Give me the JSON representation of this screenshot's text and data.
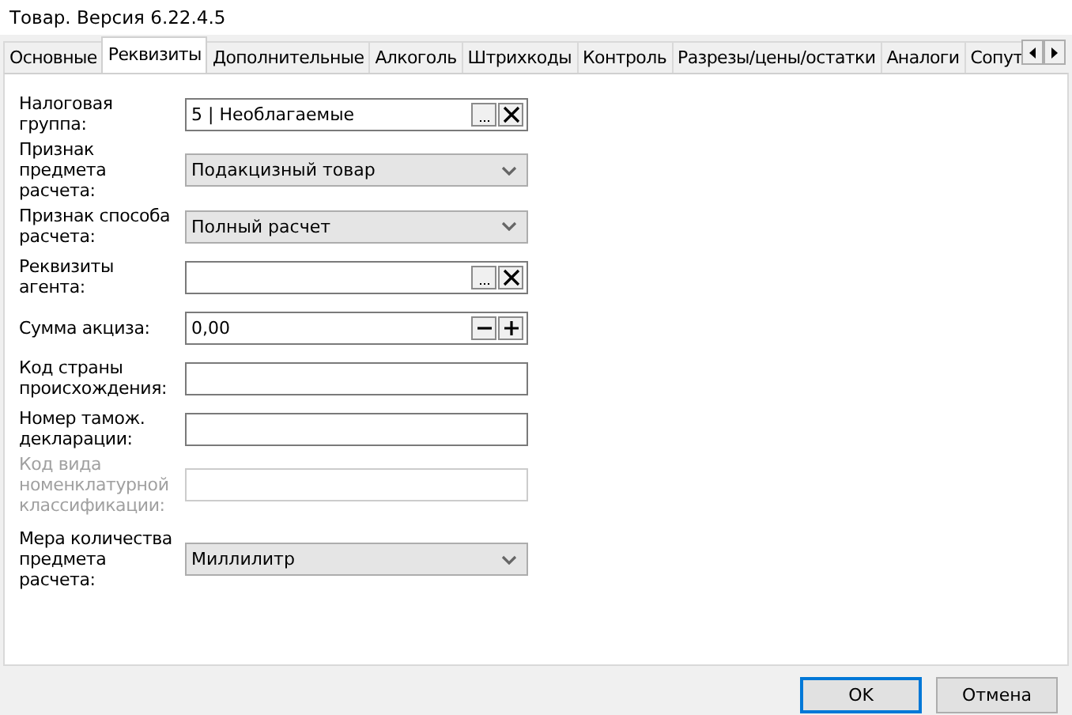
{
  "window": {
    "title": "Товар. Версия 6.22.4.5"
  },
  "tabs": [
    {
      "label": "Основные",
      "selected": false
    },
    {
      "label": "Реквизиты",
      "selected": true
    },
    {
      "label": "Дополнительные",
      "selected": false
    },
    {
      "label": "Алкоголь",
      "selected": false
    },
    {
      "label": "Штрихкоды",
      "selected": false
    },
    {
      "label": "Контроль",
      "selected": false
    },
    {
      "label": "Разрезы/цены/остатки",
      "selected": false
    },
    {
      "label": "Аналоги",
      "selected": false
    },
    {
      "label": "Сопут",
      "selected": false
    }
  ],
  "fields": [
    {
      "kind": "lookup",
      "label": "Налоговая группа:",
      "value": "5 | Необлагаемые",
      "disabled": false
    },
    {
      "kind": "select",
      "label": "Признак предмета расчета:",
      "value": "Подакцизный товар",
      "disabled": false
    },
    {
      "kind": "select",
      "label": "Признак способа расчета:",
      "value": "Полный расчет",
      "disabled": false
    },
    {
      "kind": "lookup",
      "label": "Реквизиты агента:",
      "disabled": false
    },
    {
      "kind": "spin",
      "label": "Сумма акциза:",
      "value": "0,00",
      "disabled": false
    },
    {
      "kind": "text",
      "label": "Код страны происхождения:",
      "disabled": false
    },
    {
      "kind": "text",
      "label": "Номер тамож. декларации:",
      "disabled": false
    },
    {
      "kind": "text",
      "label": "Код вида номенклатурной классификации:",
      "disabled": true
    },
    {
      "kind": "select",
      "label": "Мера количества предмета расчета:",
      "value": "Миллилитр",
      "disabled": false
    }
  ],
  "buttons": [
    {
      "label": "OK",
      "default": true
    },
    {
      "label": "Отмена",
      "default": false
    }
  ]
}
